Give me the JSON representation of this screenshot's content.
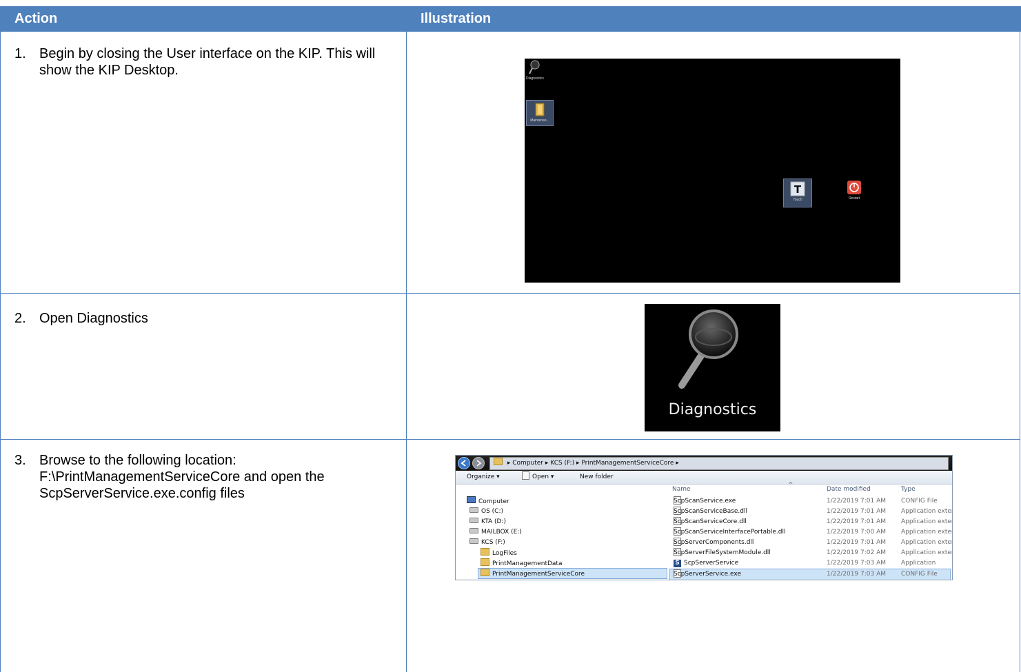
{
  "table": {
    "col_action": "Action",
    "col_illustration": "Illustration",
    "steps": [
      {
        "num": "1.",
        "text": "Begin by closing the User interface on the KIP. This will show the KIP Desktop."
      },
      {
        "num": "2.",
        "text": "Open Diagnostics"
      },
      {
        "num": "3.",
        "text": "Browse to the following location: F:\\PrintManagementServiceCore and open the ScpServerService.exe.config files"
      }
    ]
  },
  "desktop": {
    "icons": [
      "Diagnostics",
      "Maintenan...",
      "Touch",
      "Restart"
    ]
  },
  "diagnostics_icon": {
    "label": "Diagnostics"
  },
  "explorer": {
    "breadcrumb": [
      "Computer",
      "KCS (F:)",
      "PrintManagementServiceCore"
    ],
    "toolbar": {
      "organize": "Organize ▾",
      "open": "Open ▾",
      "new_folder": "New folder"
    },
    "tree": [
      "Computer",
      "OS (C:)",
      "KTA (D:)",
      "MAILBOX (E:)",
      "KCS (F:)",
      "LogFiles",
      "PrintManagementData",
      "PrintManagementServiceCore"
    ],
    "columns": {
      "name": "Name",
      "date": "Date modified",
      "type": "Type"
    },
    "files": [
      {
        "name": "ScpScanService.exe",
        "date": "1/22/2019 7:01 AM",
        "type": "CONFIG File"
      },
      {
        "name": "ScpScanServiceBase.dll",
        "date": "1/22/2019 7:01 AM",
        "type": "Application extens..."
      },
      {
        "name": "ScpScanServiceCore.dll",
        "date": "1/22/2019 7:01 AM",
        "type": "Application extens..."
      },
      {
        "name": "ScpScanServiceInterfacePortable.dll",
        "date": "1/22/2019 7:00 AM",
        "type": "Application extens..."
      },
      {
        "name": "ScpServerComponents.dll",
        "date": "1/22/2019 7:01 AM",
        "type": "Application extens..."
      },
      {
        "name": "ScpServerFileSystemModule.dll",
        "date": "1/22/2019 7:02 AM",
        "type": "Application extens..."
      },
      {
        "name": "ScpServerService",
        "date": "1/22/2019 7:03 AM",
        "type": "Application"
      },
      {
        "name": "ScpServerService.exe",
        "date": "1/22/2019 7:03 AM",
        "type": "CONFIG File"
      }
    ]
  }
}
